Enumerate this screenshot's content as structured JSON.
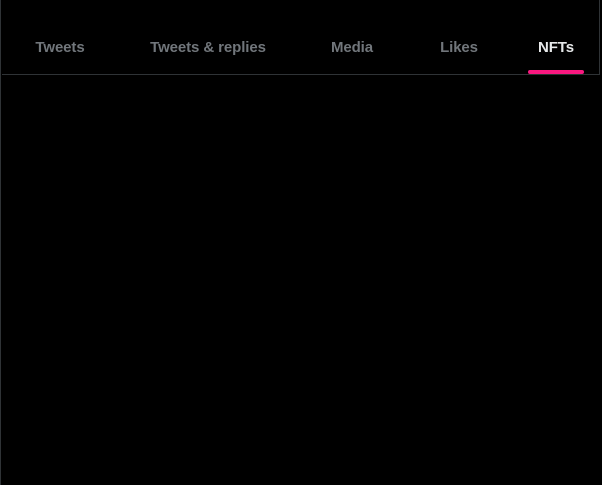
{
  "profile": {
    "avatar_icon": "avatar-image"
  },
  "tabs": [
    {
      "label": "Tweets",
      "active": false
    },
    {
      "label": "Tweets & replies",
      "active": false
    },
    {
      "label": "Media",
      "active": false
    },
    {
      "label": "Likes",
      "active": false
    },
    {
      "label": "NFTs",
      "active": true
    }
  ],
  "colors": {
    "background": "#000000",
    "active_text": "#e7e9ea",
    "inactive_text": "#71767b",
    "indicator": "#f91880",
    "border": "#2f3336"
  }
}
